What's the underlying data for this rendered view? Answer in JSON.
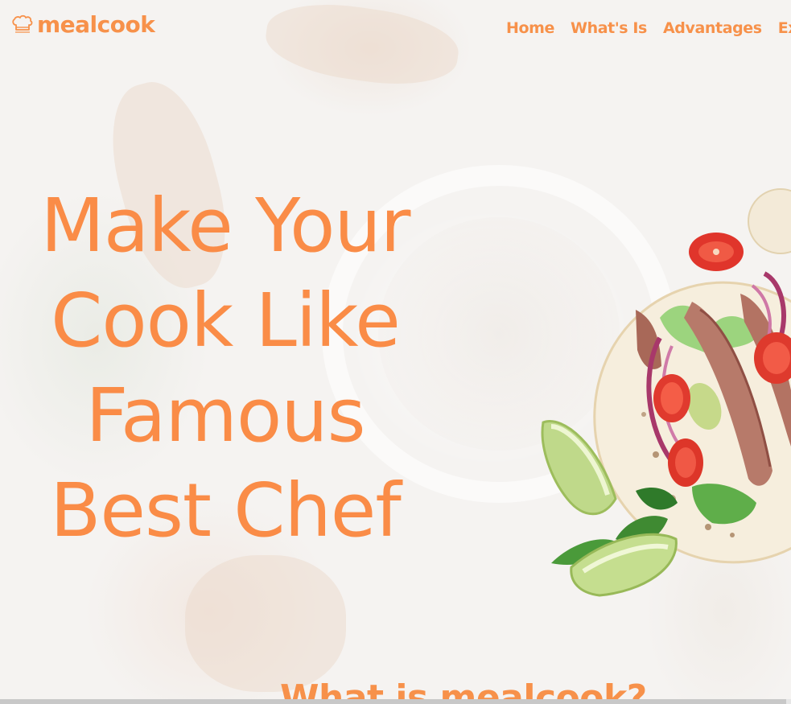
{
  "brand": {
    "name": "mealcook",
    "logo_icon": "chef-hat-icon",
    "accent_color": "#f7914a"
  },
  "nav": {
    "items": [
      "Home",
      "What's Is",
      "Advantages",
      "Exam"
    ]
  },
  "hero": {
    "title_lines": [
      "Make Your",
      "Cook Like",
      "Famous",
      "Best Chef"
    ],
    "image": "taco-with-lime-image"
  },
  "next_section": {
    "title": "What is mealcook?"
  }
}
